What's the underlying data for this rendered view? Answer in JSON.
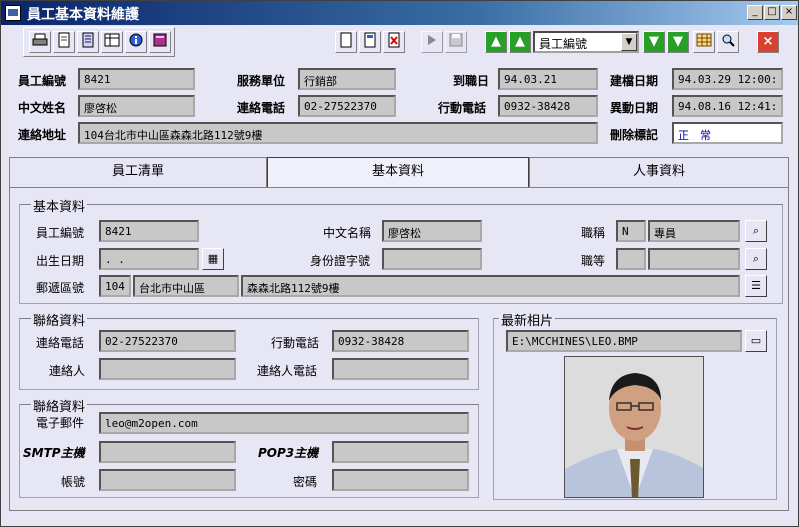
{
  "window": {
    "title": "員工基本資料維護",
    "controls": {
      "minimize": "_",
      "maximize": "□",
      "close": "×"
    }
  },
  "toolbar": {
    "combo_value": "員工編號",
    "combo_arrow": "▼",
    "tools_left": [
      "printer-icon",
      "document-icon",
      "notebook-icon",
      "table-icon",
      "info-icon",
      "book-icon"
    ],
    "tools_mid": [
      "new-icon",
      "edit-icon",
      "delete-icon",
      "undo-icon",
      "save-icon"
    ],
    "nav_up_first": "▲",
    "nav_up": "▲",
    "nav_down": "▼",
    "nav_down_last": "▼",
    "exit_label": "×"
  },
  "header": {
    "emp_no_label": "員工編號",
    "emp_no": "8421",
    "dept_label": "服務單位",
    "dept": "行銷部",
    "hire_label": "到職日",
    "hire_date": "94.03.21",
    "created_label": "建檔日期",
    "created": "94.03.29 12:00:",
    "name_label": "中文姓名",
    "name": "廖啓松",
    "phone_label": "連絡電話",
    "phone": "02-27522370",
    "mobile_label": "行動電話",
    "mobile": "0932-38428",
    "modified_label": "異動日期",
    "modified": "94.08.16 12:41:",
    "address_label": "連絡地址",
    "address": "104台北市中山區森森北路112號9樓",
    "deleted_label": "刪除標記",
    "deleted": "正　常"
  },
  "tabs": [
    {
      "label": "員工清單"
    },
    {
      "label": "基本資料"
    },
    {
      "label": "人事資料"
    }
  ],
  "basic": {
    "title": "基本資料",
    "emp_no_label": "員工編號",
    "emp_no": "8421",
    "name_label": "中文名稱",
    "name": "廖啓松",
    "title_label": "職稱",
    "title_code": "N",
    "title_name": "專員",
    "birth_label": "出生日期",
    "birth": "  .  .",
    "id_label": "身份證字號",
    "id_value": "",
    "grade_label": "職等",
    "grade_code": "",
    "grade_name": "",
    "zip_label": "郵遞區號",
    "zip": "104",
    "city": "台北市中山區",
    "street": "森森北路112號9樓"
  },
  "contact": {
    "title": "聯絡資料",
    "phone_label": "連絡電話",
    "phone": "02-27522370",
    "mobile_label": "行動電話",
    "mobile": "0932-38428",
    "person_label": "連絡人",
    "person": "",
    "person_phone_label": "連絡人電話",
    "person_phone": ""
  },
  "mail": {
    "title": "聯絡資料",
    "email_label": "電子郵件",
    "email": "leo@m2open.com",
    "smtp_label": "SMTP主機",
    "smtp": "",
    "pop3_label": "POP3主機",
    "pop3": "",
    "account_label": "帳號",
    "account": "",
    "password_label": "密碼",
    "password": ""
  },
  "photo": {
    "title": "最新相片",
    "path": "E:\\MCCHINES\\LEO.BMP"
  }
}
